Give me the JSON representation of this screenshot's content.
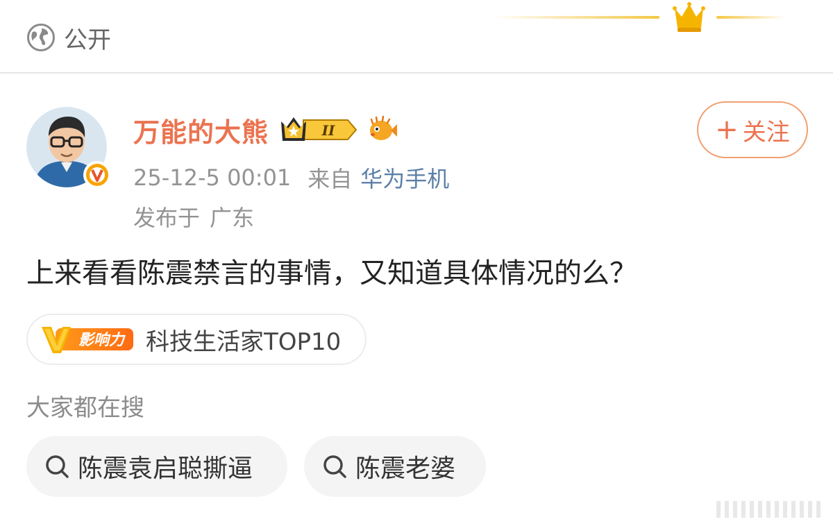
{
  "header": {
    "visibility_icon": "globe-icon",
    "visibility_label": "公开",
    "decoration_icon": "crown-icon"
  },
  "author": {
    "name": "万能的大熊",
    "verified_badge": "v-badge-icon",
    "level_badge_text": "II",
    "fish_badge_icon": "pufferfish-icon",
    "follow_label": "关注",
    "follow_icon": "plus-icon"
  },
  "meta": {
    "timestamp": "25-12-5 00:01",
    "from_label": "来自",
    "device": "华为手机",
    "location_label": "发布于",
    "location": "广东"
  },
  "post": {
    "text": "上来看看陈震禁言的事情，又知道具体情况的么？"
  },
  "influence": {
    "logo_letter": "V",
    "logo_text": "影响力",
    "tag_text": "科技生活家TOP10"
  },
  "search": {
    "heading": "大家都在搜",
    "chips": [
      {
        "label": "陈震袁启聪撕逼",
        "icon": "search-icon"
      },
      {
        "label": "陈震老婆",
        "icon": "search-icon"
      }
    ]
  },
  "colors": {
    "accent_orange": "#eb7350",
    "device_blue": "#5b7fa8",
    "meta_gray": "#939393",
    "gold": "#f5b400"
  }
}
